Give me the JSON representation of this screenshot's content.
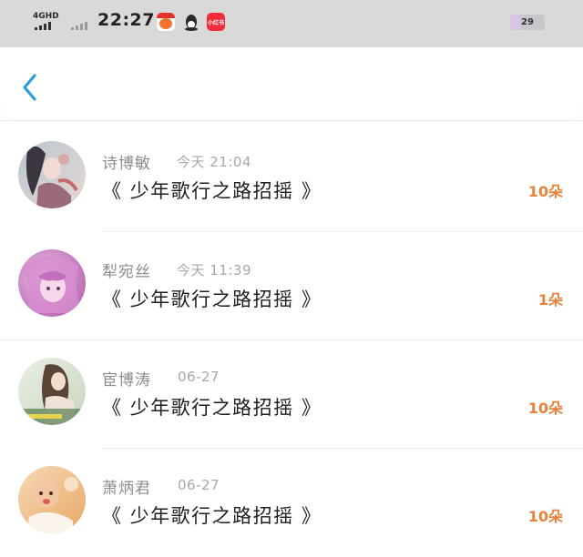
{
  "status_bar": {
    "network": "4GHD",
    "time": "22:27",
    "app_badge_text": "小红书",
    "battery": "29",
    "battery_level": 0.29
  },
  "header": {
    "back_icon": "chevron-left-icon",
    "accent_color": "#2c9be0"
  },
  "records": [
    {
      "name": "诗博敏",
      "date": "今天 21:04",
      "title": "《 少年歌行之路招摇 》",
      "amount": "10朵"
    },
    {
      "name": "犁宛丝",
      "date": "今天 11:39",
      "title": "《 少年歌行之路招摇 》",
      "amount": "1朵"
    },
    {
      "name": "宦博涛",
      "date": "06-27",
      "title": "《 少年歌行之路招摇 》",
      "amount": "10朵"
    },
    {
      "name": "萧炳君",
      "date": "06-27",
      "title": "《 少年歌行之路招摇 》",
      "amount": "10朵"
    }
  ],
  "colors": {
    "amount": "#e8823a",
    "status_bar_bg": "#d9d9d9"
  }
}
